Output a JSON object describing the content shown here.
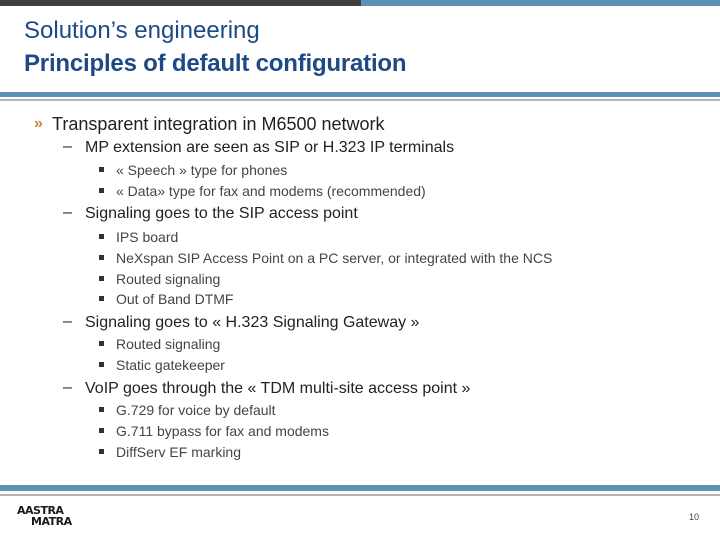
{
  "header": {
    "title": "Solution’s engineering",
    "subtitle": "Principles of default configuration"
  },
  "content": {
    "level1_marker": "»",
    "level2_marker": "–",
    "items": [
      {
        "level": 1,
        "text": "Transparent integration in M6500 network"
      },
      {
        "level": 2,
        "text": "MP extension are seen as SIP or H.323 IP terminals"
      },
      {
        "level": 3,
        "text": "« Speech » type for phones"
      },
      {
        "level": 3,
        "text": "« Data» type for fax and modems (recommended)"
      },
      {
        "level": 2,
        "text": "Signaling goes to the SIP access point"
      },
      {
        "level": 3,
        "text": "IPS board"
      },
      {
        "level": 3,
        "text": "NeXspan SIP Access Point on a PC server, or integrated with the NCS"
      },
      {
        "level": 3,
        "text": "Routed signaling"
      },
      {
        "level": 3,
        "text": "Out of Band DTMF"
      },
      {
        "level": 2,
        "text": "Signaling goes to « H.323 Signaling Gateway »"
      },
      {
        "level": 3,
        "text": "Routed signaling"
      },
      {
        "level": 3,
        "text": "Static gatekeeper"
      },
      {
        "level": 2,
        "text": "VoIP goes through the « TDM multi-site access point »"
      },
      {
        "level": 3,
        "text": "G.729 for voice by default"
      },
      {
        "level": 3,
        "text": "G.711 bypass for fax and modems"
      },
      {
        "level": 3,
        "text": "DiffServ EF marking"
      }
    ]
  },
  "footer": {
    "logo_line1": "AASTRA",
    "logo_line2": "MATRA",
    "page_number": "10"
  },
  "colors": {
    "title": "#1d4a86",
    "accent_bar": "#5b93b4",
    "top_bar_dark": "#404040",
    "level1_marker": "#c58a2e"
  }
}
